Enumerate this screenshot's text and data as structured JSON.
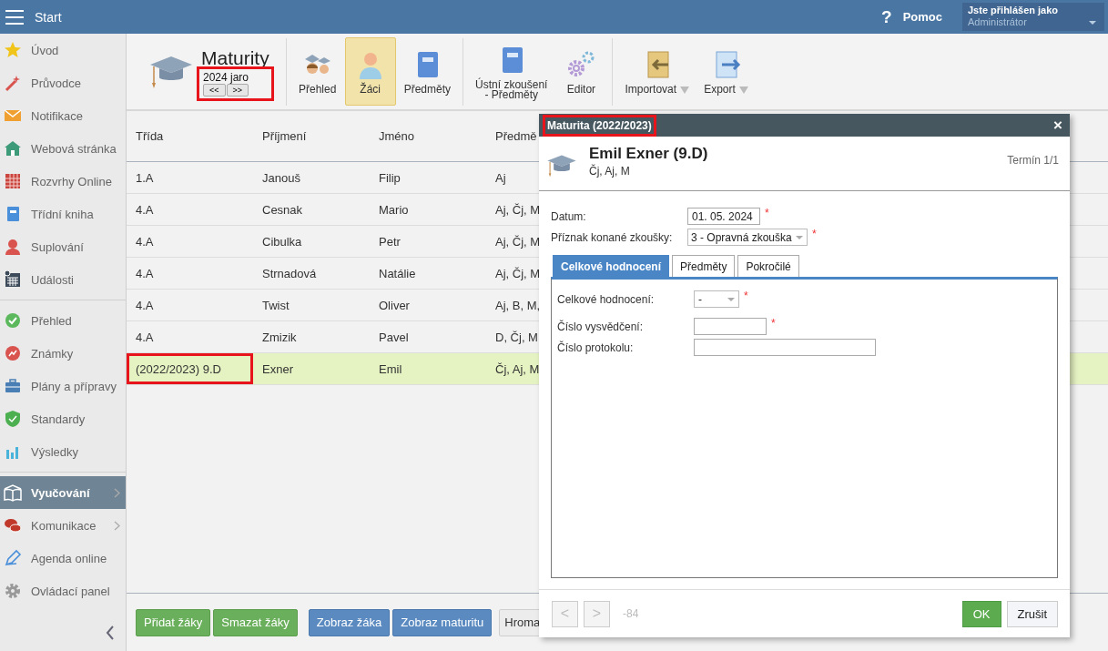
{
  "top_bar": {
    "title": "Start",
    "help": {
      "icon": "?",
      "label": "Pomoc"
    },
    "user": {
      "caption": "Jste přihlášen jako",
      "name": "Administrátor"
    }
  },
  "sidebar": {
    "groups": [
      [
        {
          "label": "Úvod",
          "selected": false,
          "has_submenu": false
        },
        {
          "label": "Průvodce",
          "selected": false,
          "has_submenu": false
        },
        {
          "label": "Notifikace",
          "selected": false,
          "has_submenu": false
        },
        {
          "label": "Webová stránka",
          "selected": false,
          "has_submenu": false
        },
        {
          "label": "Rozvrhy Online",
          "selected": false,
          "has_submenu": false
        },
        {
          "label": "Třídní kniha",
          "selected": false,
          "has_submenu": false
        },
        {
          "label": "Suplování",
          "selected": false,
          "has_submenu": false
        },
        {
          "label": "Události",
          "selected": false,
          "has_submenu": false
        }
      ],
      [
        {
          "label": "Přehled",
          "selected": false,
          "has_submenu": false
        },
        {
          "label": "Známky",
          "selected": false,
          "has_submenu": false
        },
        {
          "label": "Plány a přípravy",
          "selected": false,
          "has_submenu": false
        },
        {
          "label": "Standardy",
          "selected": false,
          "has_submenu": false
        },
        {
          "label": "Výsledky",
          "selected": false,
          "has_submenu": false
        }
      ],
      [
        {
          "label": "Vyučování",
          "selected": true,
          "has_submenu": true
        },
        {
          "label": "Komunikace",
          "selected": false,
          "has_submenu": true
        },
        {
          "label": "Agenda online",
          "selected": false,
          "has_submenu": false
        },
        {
          "label": "Ovládací panel",
          "selected": false,
          "has_submenu": false
        }
      ]
    ]
  },
  "toolbar": {
    "title": "Maturity",
    "period": {
      "label": "2024 jaro",
      "prev": "<<",
      "next": ">>",
      "highlighted": true
    },
    "groups": [
      [
        {
          "label": "Přehled",
          "selected": false,
          "has_menu": false
        },
        {
          "label": "Žáci",
          "selected": true,
          "has_menu": false
        },
        {
          "label": "Předměty",
          "selected": false,
          "has_menu": false
        }
      ],
      [
        {
          "label": "Ústní zkoušení\n- Předměty",
          "selected": false,
          "has_menu": false
        },
        {
          "label": "Editor",
          "selected": false,
          "has_menu": false
        }
      ],
      [
        {
          "label": "Importovat",
          "selected": false,
          "has_menu": true
        },
        {
          "label": "Export",
          "selected": false,
          "has_menu": true
        }
      ]
    ]
  },
  "table": {
    "columns": [
      "Třída",
      "Příjmení",
      "Jméno",
      "Předmě"
    ],
    "rows": [
      {
        "cells": [
          "1.A",
          "Janouš",
          "Filip",
          "Aj"
        ],
        "selected": false,
        "highlighted": false
      },
      {
        "cells": [
          "4.A",
          "Cesnak",
          "Mario",
          "Aj, Čj, M"
        ],
        "selected": false,
        "highlighted": false
      },
      {
        "cells": [
          "4.A",
          "Cibulka",
          "Petr",
          "Aj, Čj, M"
        ],
        "selected": false,
        "highlighted": false
      },
      {
        "cells": [
          "4.A",
          "Strnadová",
          "Natálie",
          "Aj, Čj, M"
        ],
        "selected": false,
        "highlighted": false
      },
      {
        "cells": [
          "4.A",
          "Twist",
          "Oliver",
          "Aj, B, M,"
        ],
        "selected": false,
        "highlighted": false
      },
      {
        "cells": [
          "4.A",
          "Zmizik",
          "Pavel",
          "D, Čj, M"
        ],
        "selected": false,
        "highlighted": false
      },
      {
        "cells": [
          "(2022/2023) 9.D",
          "Exner",
          "Emil",
          "Čj, Aj, M"
        ],
        "selected": true,
        "highlighted": true
      }
    ]
  },
  "bottom_buttons": [
    {
      "label": "Přidat žáky",
      "kind": "success"
    },
    {
      "label": "Smazat žáky",
      "kind": "success"
    },
    {
      "label": "Zobraz žáka",
      "kind": "primary"
    },
    {
      "label": "Zobraz maturitu",
      "kind": "primary"
    },
    {
      "label": "Hroma",
      "kind": "default"
    }
  ],
  "dialog": {
    "title": "Maturita (2022/2023)",
    "title_highlighted": true,
    "close": "×",
    "student": "Emil Exner (9.D)",
    "subjects": "Čj, Aj, M",
    "term": "Termín 1/1",
    "fields": [
      {
        "label": "Datum:",
        "kind": "input",
        "value": "01. 05. 2024",
        "required": true
      },
      {
        "label": "Příznak konané zkoušky:",
        "kind": "select",
        "value": "3 - Opravná zkouška",
        "required": true
      }
    ],
    "tabs": [
      {
        "label": "Celkové hodnocení",
        "selected": true
      },
      {
        "label": "Předměty",
        "selected": false
      },
      {
        "label": "Pokročilé",
        "selected": false
      }
    ],
    "panel_fields": [
      {
        "label": "Celkové hodnocení:",
        "kind": "select",
        "value": "-",
        "required": true
      },
      {
        "label": "Číslo vysvědčení:",
        "kind": "input",
        "required": true
      },
      {
        "label": "Číslo protokolu:",
        "kind": "input",
        "required": false
      }
    ],
    "required_mark": "*",
    "nav": {
      "prev": "<",
      "next": ">",
      "disabled": true,
      "counter": "-84"
    },
    "buttons": [
      {
        "label": "OK",
        "kind": "success"
      },
      {
        "label": "Zrušit",
        "kind": "default"
      }
    ]
  }
}
